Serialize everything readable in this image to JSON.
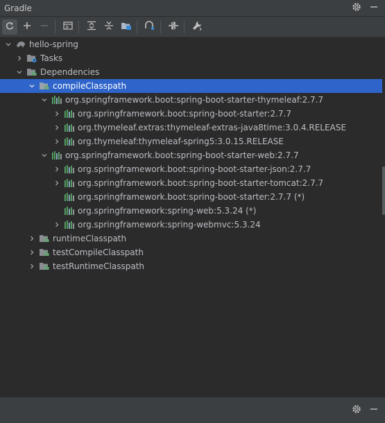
{
  "panel": {
    "title": "Gradle"
  },
  "toolbar": {
    "icons": [
      "refresh-icon",
      "add-icon",
      "remove-icon",
      "run-task-icon",
      "expand-all-icon",
      "collapse-all-icon",
      "group-modules-icon",
      "dependencies-analyzer-icon",
      "toggle-offline-icon",
      "settings-wrench-icon"
    ]
  },
  "tree": {
    "root": "hello-spring",
    "tasks": "Tasks",
    "dependencies": "Dependencies",
    "compileClasspath": "compileClasspath",
    "thymeleaf_starter": "org.springframework.boot:spring-boot-starter-thymeleaf:2.7.7",
    "starter_277": "org.springframework.boot:spring-boot-starter:2.7.7",
    "extras": "org.thymeleaf.extras:thymeleaf-extras-java8time:3.0.4.RELEASE",
    "spring5": "org.thymeleaf:thymeleaf-spring5:3.0.15.RELEASE",
    "web_starter": "org.springframework.boot:spring-boot-starter-web:2.7.7",
    "json": "org.springframework.boot:spring-boot-starter-json:2.7.7",
    "tomcat": "org.springframework.boot:spring-boot-starter-tomcat:2.7.7",
    "starter_dup": "org.springframework.boot:spring-boot-starter:2.7.7 (*)",
    "web": "org.springframework:spring-web:5.3.24 (*)",
    "webmvc": "org.springframework:spring-webmvc:5.3.24",
    "runtime": "runtimeClasspath",
    "testCompile": "testCompileClasspath",
    "testRuntime": "testRuntimeClasspath"
  },
  "colors": {
    "selection": "#2f65ca",
    "background": "#2b2b2b",
    "accent_green": "#59a869",
    "folder": "#8a8d91"
  }
}
